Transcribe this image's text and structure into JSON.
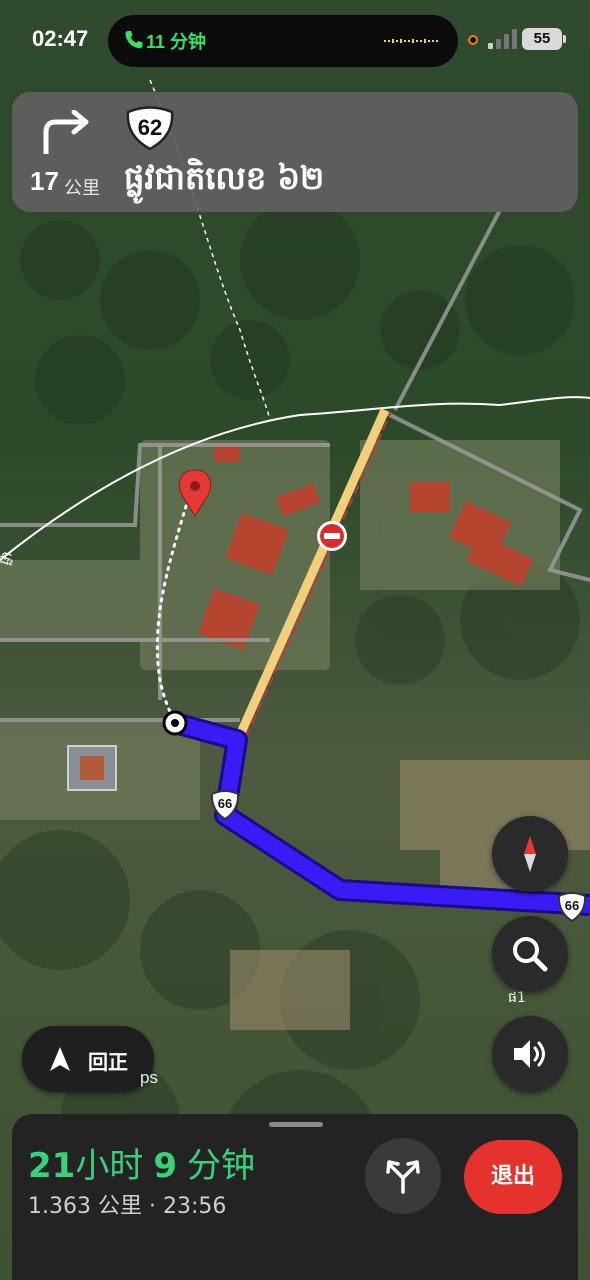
{
  "status_bar": {
    "time": "02:47",
    "call_duration": "11 分钟",
    "battery": "55",
    "colors": {
      "call": "#2ee36a",
      "recording": "#ff7a1a"
    }
  },
  "navigation": {
    "maneuver_icon": "turn-right-arrow-icon",
    "distance_value": "17",
    "distance_unit": "公里",
    "route_number": "62",
    "street_name": "ផ្លូវជាតិលេខ ៦២"
  },
  "map": {
    "route_shields": [
      "66",
      "66"
    ],
    "place_labels": [
      "ផ្លា",
      "ផ1"
    ],
    "attribution": "ps",
    "route_color": "#3b1bf5",
    "destination_icon": "red-pin-icon",
    "no-entry_icon": "no-entry-icon"
  },
  "controls": {
    "compass_icon": "compass-icon",
    "search_icon": "search-icon",
    "sound_icon": "sound-icon",
    "recenter_label": "回正"
  },
  "trip": {
    "eta_hours": "21",
    "eta_hours_unit": "小时",
    "eta_minutes": "9",
    "eta_minutes_unit": "分钟",
    "remaining_distance": "1.363 公里",
    "separator": "·",
    "arrival_time": "23:56",
    "alternates_icon": "alternate-routes-icon",
    "exit_label": "退出",
    "colors": {
      "eta": "#37d27a",
      "exit": "#e5322d"
    }
  }
}
